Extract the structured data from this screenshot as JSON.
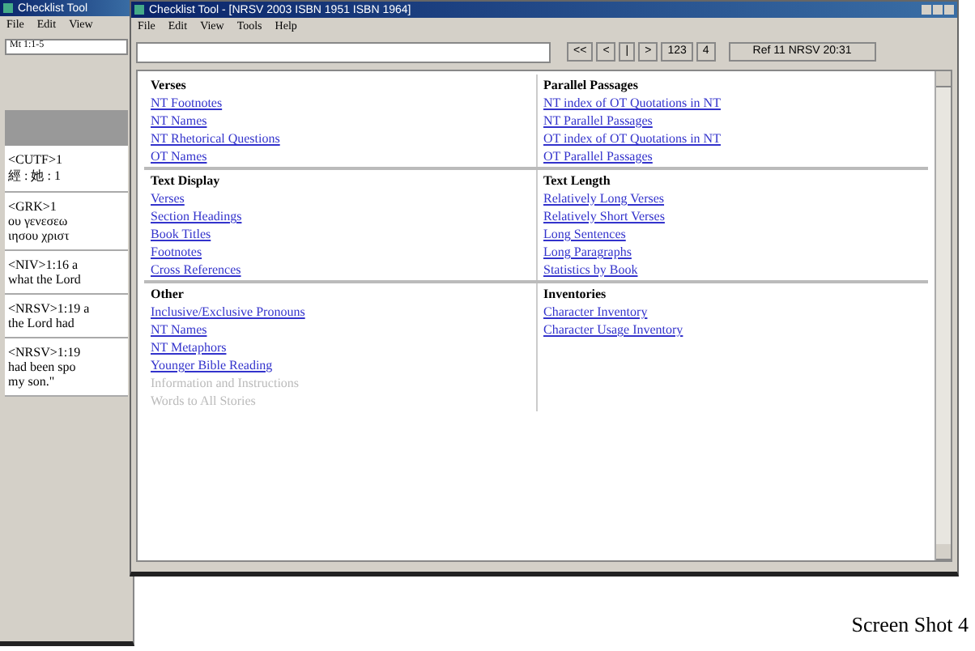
{
  "back_window": {
    "title": "Checklist Tool",
    "menu": [
      "File",
      "Edit",
      "View"
    ],
    "reference": "Mt 1:1-5",
    "passages": [
      {
        "lines": [
          "<CUTF>1",
          "經 : 她 : 1"
        ]
      },
      {
        "lines": [
          "<GRK>1",
          "ου γενεσεω",
          "ιησου χριστ"
        ]
      },
      {
        "lines": [
          "<NIV>1:16 a",
          "what the Lord"
        ]
      },
      {
        "lines": [
          "<NRSV>1:19 a",
          "the Lord had"
        ]
      },
      {
        "lines": [
          "<NRSV>1:19",
          "had been spo",
          "my son.\""
        ]
      }
    ]
  },
  "window": {
    "title": "Checklist Tool - [NRSV 2003 ISBN 1951 ISBN 1964]",
    "menu": [
      "File",
      "Edit",
      "View",
      "Tools",
      "Help"
    ],
    "nav_buttons": [
      "<<",
      "<",
      "|",
      ">"
    ],
    "view_buttons": [
      "123",
      "4"
    ],
    "reference_button": "Ref 11 NRSV 20:31",
    "sections": [
      {
        "title": "Verses",
        "links": [
          {
            "label": "NT Footnotes",
            "disabled": false
          },
          {
            "label": "NT Names",
            "disabled": false
          },
          {
            "label": "NT Rhetorical Questions",
            "disabled": false
          },
          {
            "label": "OT Names",
            "disabled": false
          }
        ]
      },
      {
        "title": "Parallel Passages",
        "links": [
          {
            "label": "NT index of OT Quotations in NT",
            "disabled": false
          },
          {
            "label": "NT Parallel Passages",
            "disabled": false
          },
          {
            "label": "OT index of OT Quotations in NT",
            "disabled": false
          },
          {
            "label": "OT Parallel Passages",
            "disabled": false
          }
        ]
      },
      {
        "title": "Text Display",
        "links": [
          {
            "label": "Verses",
            "disabled": false
          },
          {
            "label": "Section Headings",
            "disabled": false
          },
          {
            "label": "Book Titles",
            "disabled": false
          },
          {
            "label": "Footnotes",
            "disabled": false
          },
          {
            "label": "Cross References",
            "disabled": false
          }
        ]
      },
      {
        "title": "Text Length",
        "links": [
          {
            "label": "Relatively Long Verses",
            "disabled": false
          },
          {
            "label": "Relatively Short Verses",
            "disabled": false
          },
          {
            "label": "Long Sentences",
            "disabled": false
          },
          {
            "label": "Long Paragraphs",
            "disabled": false
          },
          {
            "label": "Statistics by Book",
            "disabled": false
          }
        ]
      },
      {
        "title": "Other",
        "links": [
          {
            "label": "Inclusive/Exclusive Pronouns",
            "disabled": false
          },
          {
            "label": "NT Names",
            "disabled": false
          },
          {
            "label": "NT Metaphors",
            "disabled": false
          },
          {
            "label": "Younger Bible Reading",
            "disabled": false
          },
          {
            "label": "Information and Instructions",
            "disabled": true
          },
          {
            "label": "Words to All Stories",
            "disabled": true
          }
        ]
      },
      {
        "title": "Inventories",
        "links": [
          {
            "label": "Character Inventory",
            "disabled": false
          },
          {
            "label": "Character Usage Inventory",
            "disabled": false
          }
        ]
      }
    ]
  },
  "caption": "Screen Shot 4"
}
